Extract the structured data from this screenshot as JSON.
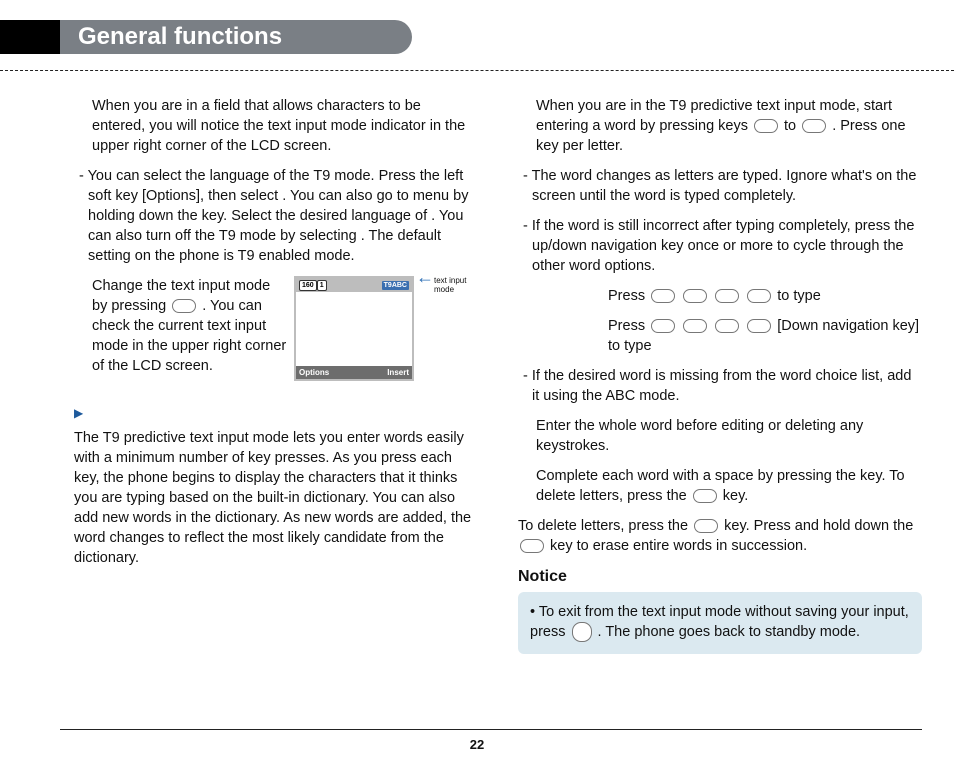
{
  "header": {
    "title": "General functions"
  },
  "col1": {
    "p1": "When you are in a field that allows characters to be entered, you will notice the text input mode indicator in the upper right corner of the LCD screen.",
    "p2": "- You can select the language of the T9 mode. Press the left soft key [Options], then select               . You can also go to                      menu by holding down the        key. Select the desired language of         . You can also turn off the T9 mode by selecting         . The default setting on the phone is T9 enabled mode.",
    "phoneText": "Change the text input mode by pressing          . You can check the current text input mode in the upper right corner of the LCD screen.",
    "phone": {
      "cnt1": "160",
      "cnt2": "1",
      "t9": "T9ABC",
      "left": "Options",
      "right": "Insert"
    },
    "caption": "text input mode",
    "p3": "The T9 predictive text input mode lets you enter words easily with a minimum number of key presses. As you press each key, the phone begins to display the characters that it thinks you are typing based on the built-in dictionary. You can also add new words in the dictionary. As new words are added, the word changes to reflect the most likely candidate from the dictionary."
  },
  "col2": {
    "p1": "When you are in the T9 predictive text input mode, start entering a word by pressing keys         to         . Press one key per letter.",
    "b1": "- The word changes as letters are typed. Ignore what's on the screen until the word is typed completely.",
    "b2": "- If the word is still incorrect after typing completely, press the up/down navigation key once or more to cycle through the other word options.",
    "ex1a": "Press",
    "ex1b": "to type",
    "ex2a": "Press",
    "ex2b": "[Down navigation key] to type",
    "b3": "- If the desired word is missing from the word choice list, add it using the ABC mode.",
    "s1": "Enter the whole word before editing or deleting any keystrokes.",
    "s2": "Complete each word with a space by pressing the key. To delete letters, press the          key.",
    "p4": "To delete letters, press the            key. Press and hold down the            key to erase entire words in succession.",
    "noticeH": "Notice",
    "notice": "• To exit from the text input mode without saving your input, press          . The phone goes back to standby mode."
  },
  "page": "22"
}
